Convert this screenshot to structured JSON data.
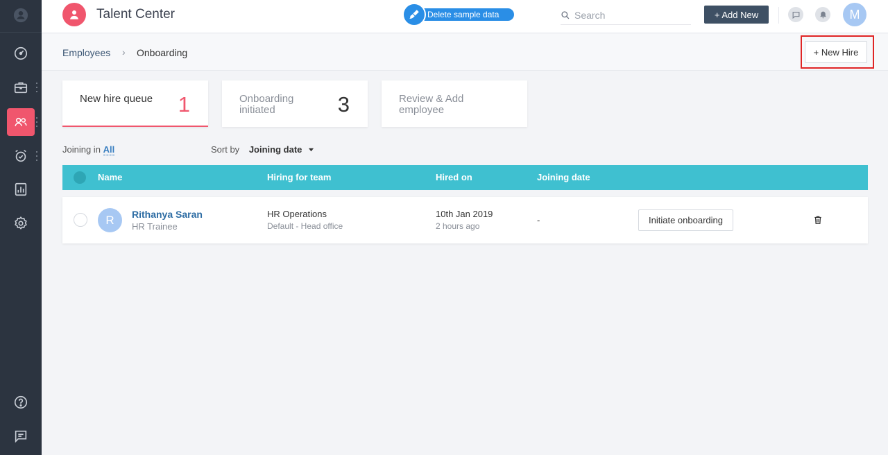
{
  "app": {
    "title": "Talent Center"
  },
  "topbar": {
    "delete_sample": "Delete sample data",
    "search_placeholder": "Search",
    "add_new": "+ Add New",
    "avatar_initial": "M"
  },
  "breadcrumb": {
    "parent": "Employees",
    "separator": "›",
    "current": "Onboarding"
  },
  "actions": {
    "new_hire": "+ New Hire"
  },
  "cards": [
    {
      "label": "New hire queue",
      "count": "1"
    },
    {
      "label": "Onboarding initiated",
      "count": "3"
    },
    {
      "label": "Review & Add employee",
      "count": ""
    }
  ],
  "filters": {
    "joining_label": "Joining in",
    "joining_value": "All",
    "sort_label": "Sort by",
    "sort_value": "Joining date"
  },
  "table": {
    "headers": [
      "Name",
      "Hiring for team",
      "Hired on",
      "Joining date"
    ],
    "rows": [
      {
        "initial": "R",
        "name": "Rithanya Saran",
        "role": "HR Trainee",
        "team": "HR Operations",
        "team_sub": "Default - Head office",
        "hired_on": "10th Jan 2019",
        "hired_ago": "2 hours ago",
        "joining_date": "-",
        "action": "Initiate onboarding"
      }
    ]
  },
  "colors": {
    "accent": "#f0566d",
    "table_header": "#3fc0d0",
    "sidebar": "#2c3440",
    "highlight": "#e02424"
  }
}
